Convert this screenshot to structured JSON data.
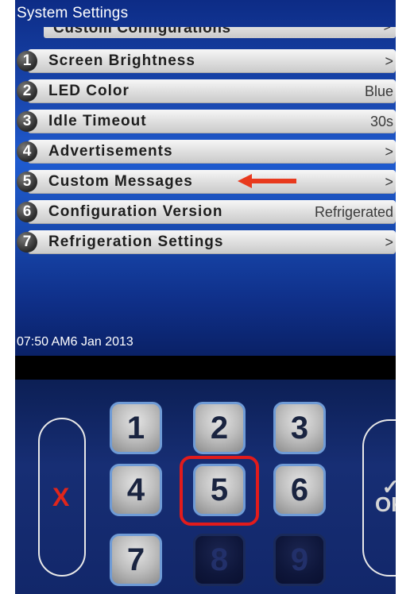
{
  "header": {
    "title": "System Settings",
    "clipped_item_label": "Custom Configurations",
    "clipped_item_value": ">"
  },
  "menu": {
    "items": [
      {
        "num": "1",
        "label": "Screen Brightness",
        "value": ">"
      },
      {
        "num": "2",
        "label": "LED Color",
        "value": "Blue"
      },
      {
        "num": "3",
        "label": "Idle Timeout",
        "value": "30s"
      },
      {
        "num": "4",
        "label": "Advertisements",
        "value": ">"
      },
      {
        "num": "5",
        "label": "Custom Messages",
        "value": ">"
      },
      {
        "num": "6",
        "label": "Configuration Version",
        "value": "Refrigerated"
      },
      {
        "num": "7",
        "label": "Refrigeration Settings",
        "value": ">"
      }
    ]
  },
  "status": {
    "datetime": "07:50 AM6 Jan 2013"
  },
  "keypad": {
    "keys": [
      "1",
      "2",
      "3",
      "4",
      "5",
      "6",
      "7",
      "8",
      "9"
    ],
    "cancel_label": "X",
    "ok_check": "✓",
    "ok_label": "OK",
    "selected_key": "5"
  },
  "colors": {
    "screen_blue": "#1a49b2",
    "annotation_red": "#e21b1b"
  }
}
